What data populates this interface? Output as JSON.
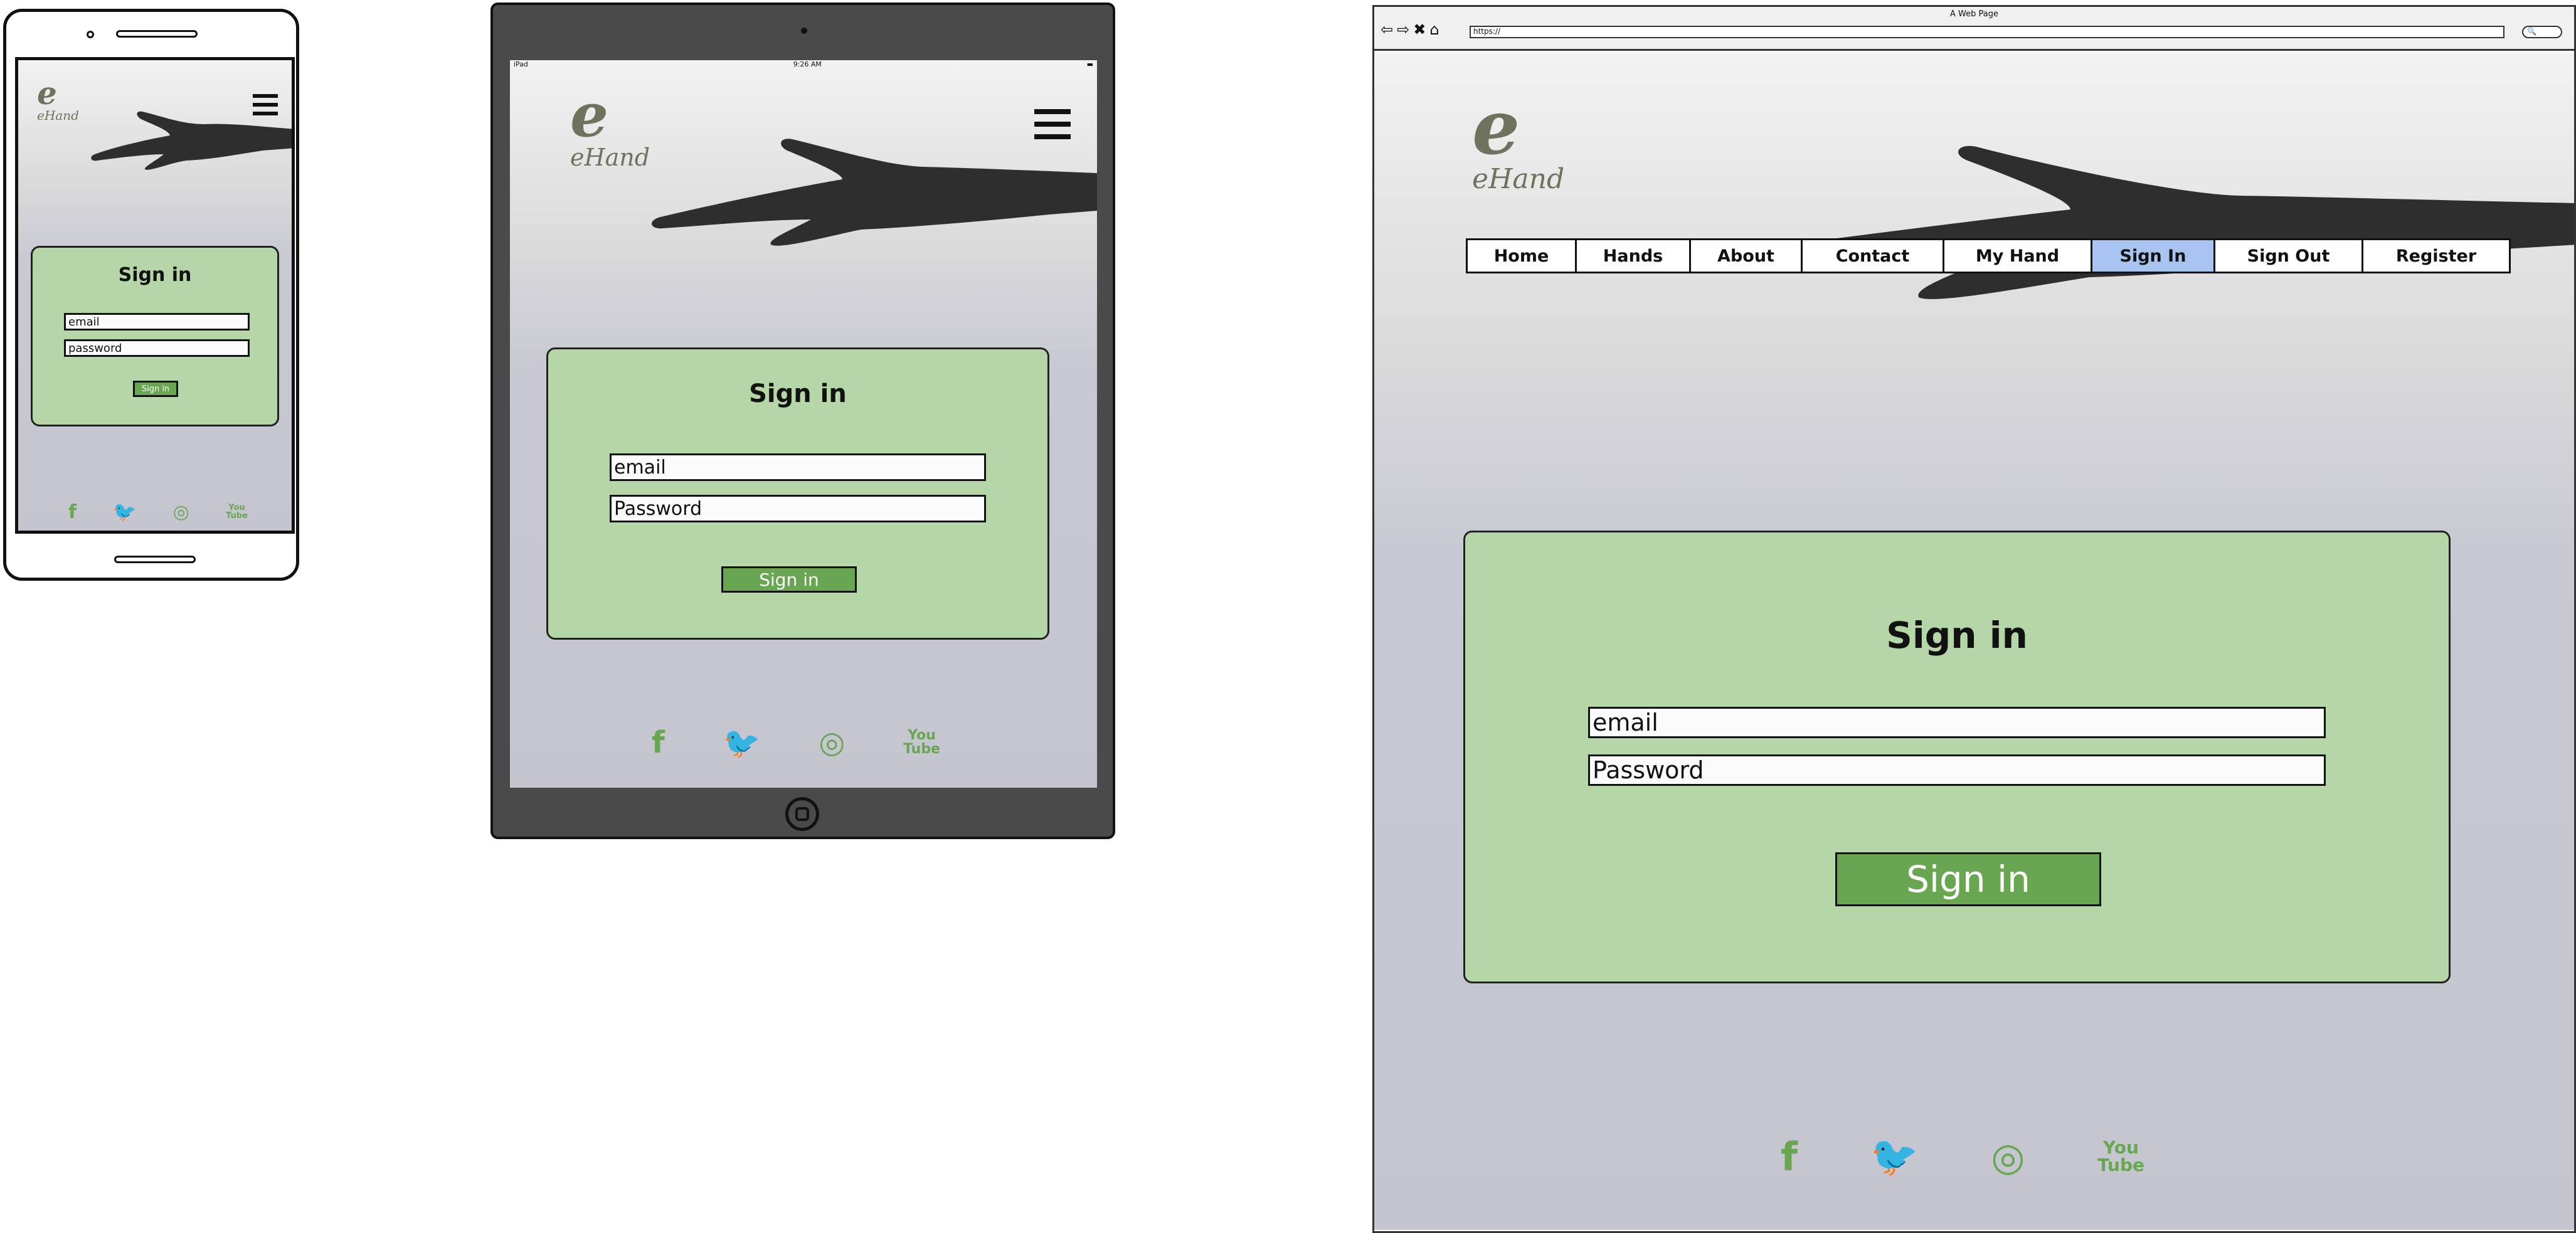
{
  "brand": {
    "name": "eHand",
    "mark": "e"
  },
  "colors": {
    "card_bg": "#b5d7a8",
    "button_bg": "#69a652",
    "icon_color": "#69a652",
    "active_nav": "#a8c4f0"
  },
  "phone": {
    "heading": "Sign in",
    "email_placeholder": "email",
    "password_placeholder": "password",
    "button_label": "Sign in"
  },
  "tablet": {
    "status": {
      "carrier": "iPad",
      "time": "9:26 AM"
    },
    "heading": "Sign in",
    "email_placeholder": "email",
    "password_placeholder": "Password",
    "button_label": "Sign in"
  },
  "desktop": {
    "window_title": "A Web Page",
    "url": "https://",
    "nav": [
      {
        "label": "Home",
        "active": false
      },
      {
        "label": "Hands",
        "active": false
      },
      {
        "label": "About",
        "active": false
      },
      {
        "label": "Contact",
        "active": false
      },
      {
        "label": "My Hand",
        "active": false
      },
      {
        "label": "Sign In",
        "active": true
      },
      {
        "label": "Sign Out",
        "active": false
      },
      {
        "label": "Register",
        "active": false
      }
    ],
    "heading": "Sign in",
    "email_placeholder": "email",
    "password_placeholder": "Password",
    "button_label": "Sign in"
  },
  "social": [
    {
      "icon": "facebook-icon",
      "glyph": "f"
    },
    {
      "icon": "twitter-icon",
      "glyph": "🐦"
    },
    {
      "icon": "instagram-icon",
      "glyph": "◎"
    },
    {
      "icon": "youtube-icon",
      "glyph": "You\nTube"
    }
  ]
}
